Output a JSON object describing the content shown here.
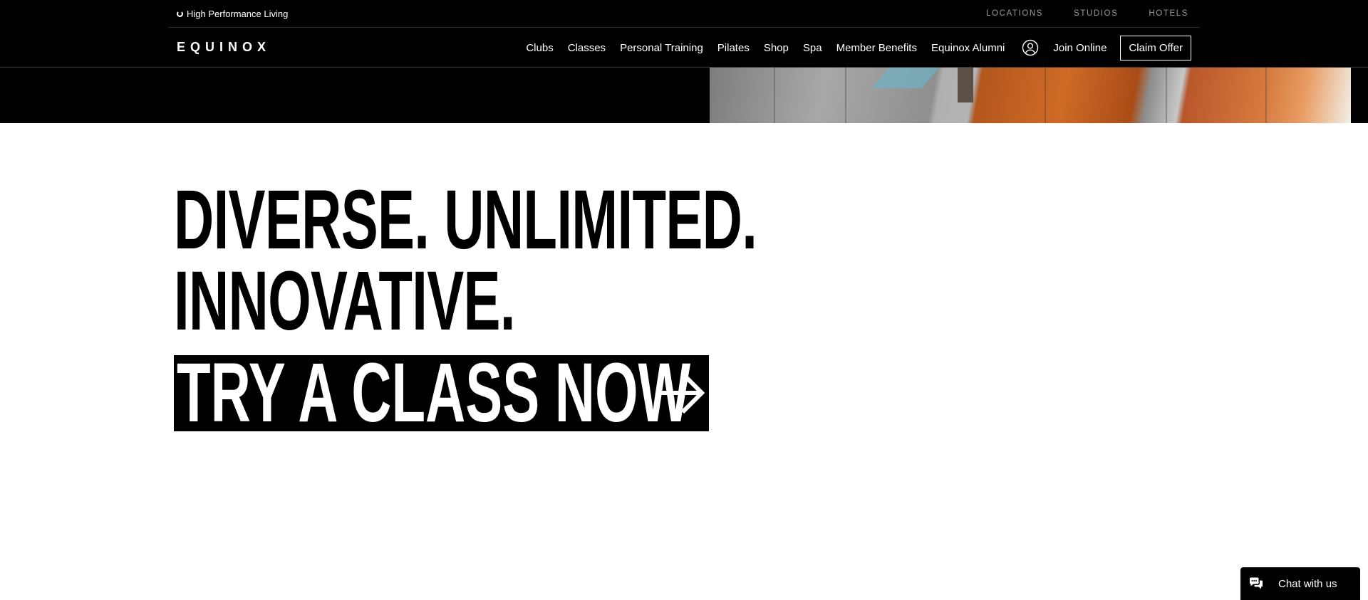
{
  "utility_bar": {
    "tagline": "High Performance Living",
    "links": [
      "LOCATIONS",
      "STUDIOS",
      "HOTELS"
    ]
  },
  "nav": {
    "logo": "EQUINOX",
    "items": [
      "Clubs",
      "Classes",
      "Personal Training",
      "Pilates",
      "Shop",
      "Spa",
      "Member Benefits",
      "Equinox Alumni"
    ],
    "join_label": "Join Online",
    "claim_label": "Claim Offer",
    "account_icon": "account-icon"
  },
  "hero": {
    "headline_line1": "DIVERSE. UNLIMITED.",
    "headline_line2": "INNOVATIVE.",
    "cta_label": "TRY A CLASS NOW",
    "cta_icon": "arrow-right-icon"
  },
  "chat": {
    "label": "Chat with us",
    "icon": "chat-bubbles-icon"
  },
  "colors": {
    "background": "#ffffff",
    "nav_background": "#000000",
    "text": "#000000",
    "nav_text": "#ffffff",
    "muted_link": "#9a9a9a"
  }
}
